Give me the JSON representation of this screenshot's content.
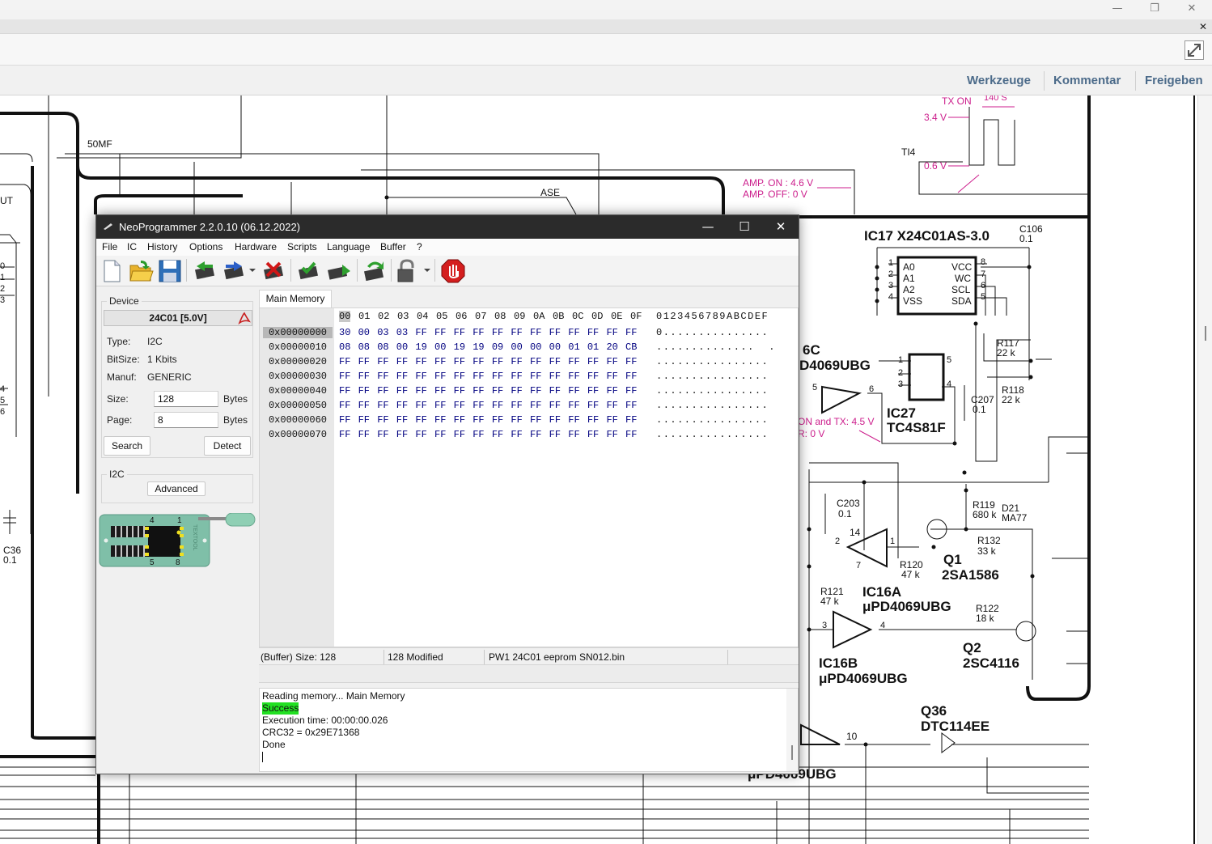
{
  "viewer": {
    "window_controls": {
      "minimize": "—",
      "maximize": "❐",
      "close": "✕"
    },
    "doc_tab_close": "✕",
    "links": [
      "Werkzeuge",
      "Kommentar",
      "Freigeben"
    ]
  },
  "schematic": {
    "labels": {
      "t50mf": "50MF",
      "ase": "ASE",
      "ut": "UT",
      "ti4": "TI4",
      "tx_on": "TX ON",
      "t140s": "140 S",
      "v34": "3.4 V",
      "v06": "0.6 V",
      "amp_on": "AMP. ON  : 4.6 V",
      "amp_off": "AMP. OFF: 0 V",
      "ic17": "IC17  X24C01AS-3.0",
      "c106": "C106",
      "c106v": "0.1",
      "a0": "A0",
      "a1": "A1",
      "a2": "A2",
      "vss": "VSS",
      "vcc": "VCC",
      "wc": "WC",
      "scl": "SCL",
      "sda": "SDA",
      "r117": "R117",
      "r117v": "22 k",
      "r118": "R118",
      "r118v": "22 k",
      "u6c": "6C",
      "u6c_part": "D4069UBG",
      "ic27": "IC27",
      "ic27_part": "TC4S81F",
      "c207": "C207",
      "c207v": "0.1",
      "on_tx": "ON and TX: 4.5 V",
      "r0v": "R: 0 V",
      "c203": "C203",
      "c203v": "0.1",
      "r119": "R119",
      "r119v": "680 k",
      "d21": "D21",
      "d21v": "MA77",
      "r132": "R132",
      "r132v": "33 k",
      "q1": "Q1",
      "q1v": "2SA1586",
      "r120": "R120",
      "r120v": "47 k",
      "r121": "R121",
      "r121v": "47 k",
      "ic16a": "IC16A",
      "ic16a_part": "μPD4069UBG",
      "r122": "R122",
      "r122v": "18 k",
      "q2": "Q2",
      "q2v": "2SC4116",
      "ic16b": "IC16B",
      "ic16b_part": "μPD4069UBG",
      "q36": "Q36",
      "q36v": "DTC114EE",
      "bottom_part": "μPD4069UBG",
      "c36": "C36",
      "c36v": "0.1",
      "n10": "10",
      "n14": "14"
    }
  },
  "np": {
    "title": "NeoProgrammer 2.2.0.10 (06.12.2022)",
    "window_controls": {
      "minimize": "—",
      "maximize": "☐",
      "close": "✕"
    },
    "menu": [
      "File",
      "IC",
      "History",
      "Options",
      "Hardware",
      "Scripts",
      "Language",
      "Buffer",
      "?"
    ],
    "device": {
      "group_label": "Device",
      "name": "24C01 [5.0V]",
      "type_label": "Type:",
      "type": "I2C",
      "bitsize_label": "BitSize:",
      "bitsize": "1 Kbits",
      "manuf_label": "Manuf:",
      "manuf": "GENERIC",
      "size_label": "Size:",
      "size": "128",
      "size_unit": "Bytes",
      "page_label": "Page:",
      "page": "8",
      "page_unit": "Bytes",
      "search": "Search",
      "detect": "Detect"
    },
    "i2c": {
      "group_label": "I2C",
      "advanced": "Advanced"
    },
    "socket": {
      "pin4": "4",
      "pin1": "1",
      "pin5": "5",
      "pin8": "8",
      "textool": "TEXTOOL"
    },
    "tab": "Main Memory",
    "hex": {
      "columns": [
        "00",
        "01",
        "02",
        "03",
        "04",
        "05",
        "06",
        "07",
        "08",
        "09",
        "0A",
        "0B",
        "0C",
        "0D",
        "0E",
        "0F"
      ],
      "ascii_header": "0123456789ABCDEF",
      "rows": [
        {
          "addr": "0x00000000",
          "bytes": "30 00 03 03 FF FF FF FF FF FF FF FF FF FF FF FF",
          "ascii": "0..............."
        },
        {
          "addr": "0x00000010",
          "bytes": "08 08 08 00 19 00 19 19 09 00 00 00 01 01 20 CB",
          "ascii": "..............  ."
        },
        {
          "addr": "0x00000020",
          "bytes": "FF FF FF FF FF FF FF FF FF FF FF FF FF FF FF FF",
          "ascii": "................"
        },
        {
          "addr": "0x00000030",
          "bytes": "FF FF FF FF FF FF FF FF FF FF FF FF FF FF FF FF",
          "ascii": "................"
        },
        {
          "addr": "0x00000040",
          "bytes": "FF FF FF FF FF FF FF FF FF FF FF FF FF FF FF FF",
          "ascii": "................"
        },
        {
          "addr": "0x00000050",
          "bytes": "FF FF FF FF FF FF FF FF FF FF FF FF FF FF FF FF",
          "ascii": "................"
        },
        {
          "addr": "0x00000060",
          "bytes": "FF FF FF FF FF FF FF FF FF FF FF FF FF FF FF FF",
          "ascii": "................"
        },
        {
          "addr": "0x00000070",
          "bytes": "FF FF FF FF FF FF FF FF FF FF FF FF FF FF FF FF",
          "ascii": "................"
        }
      ]
    },
    "status": {
      "buffer_size": "(Buffer) Size: 128",
      "modified": "128 Modified",
      "file": "PW1 24C01 eeprom SN012.bin"
    },
    "log": [
      "Reading memory... Main Memory",
      "Success",
      "Execution time: 00:00:00.026",
      "CRC32 = 0x29E71368",
      "Done"
    ],
    "colors": {
      "success_bg": "#22e022",
      "hex_bytes": "#000080",
      "schematic_magenta": "#cc1e8c"
    },
    "toolbar_icons": [
      "new-file-icon",
      "open-folder-icon",
      "save-icon",
      "read-chip-icon",
      "write-chip-icon",
      "erase-chip-icon",
      "verify-chip-icon",
      "blank-check-icon",
      "auto-icon",
      "lock-icon",
      "stop-icon"
    ]
  }
}
